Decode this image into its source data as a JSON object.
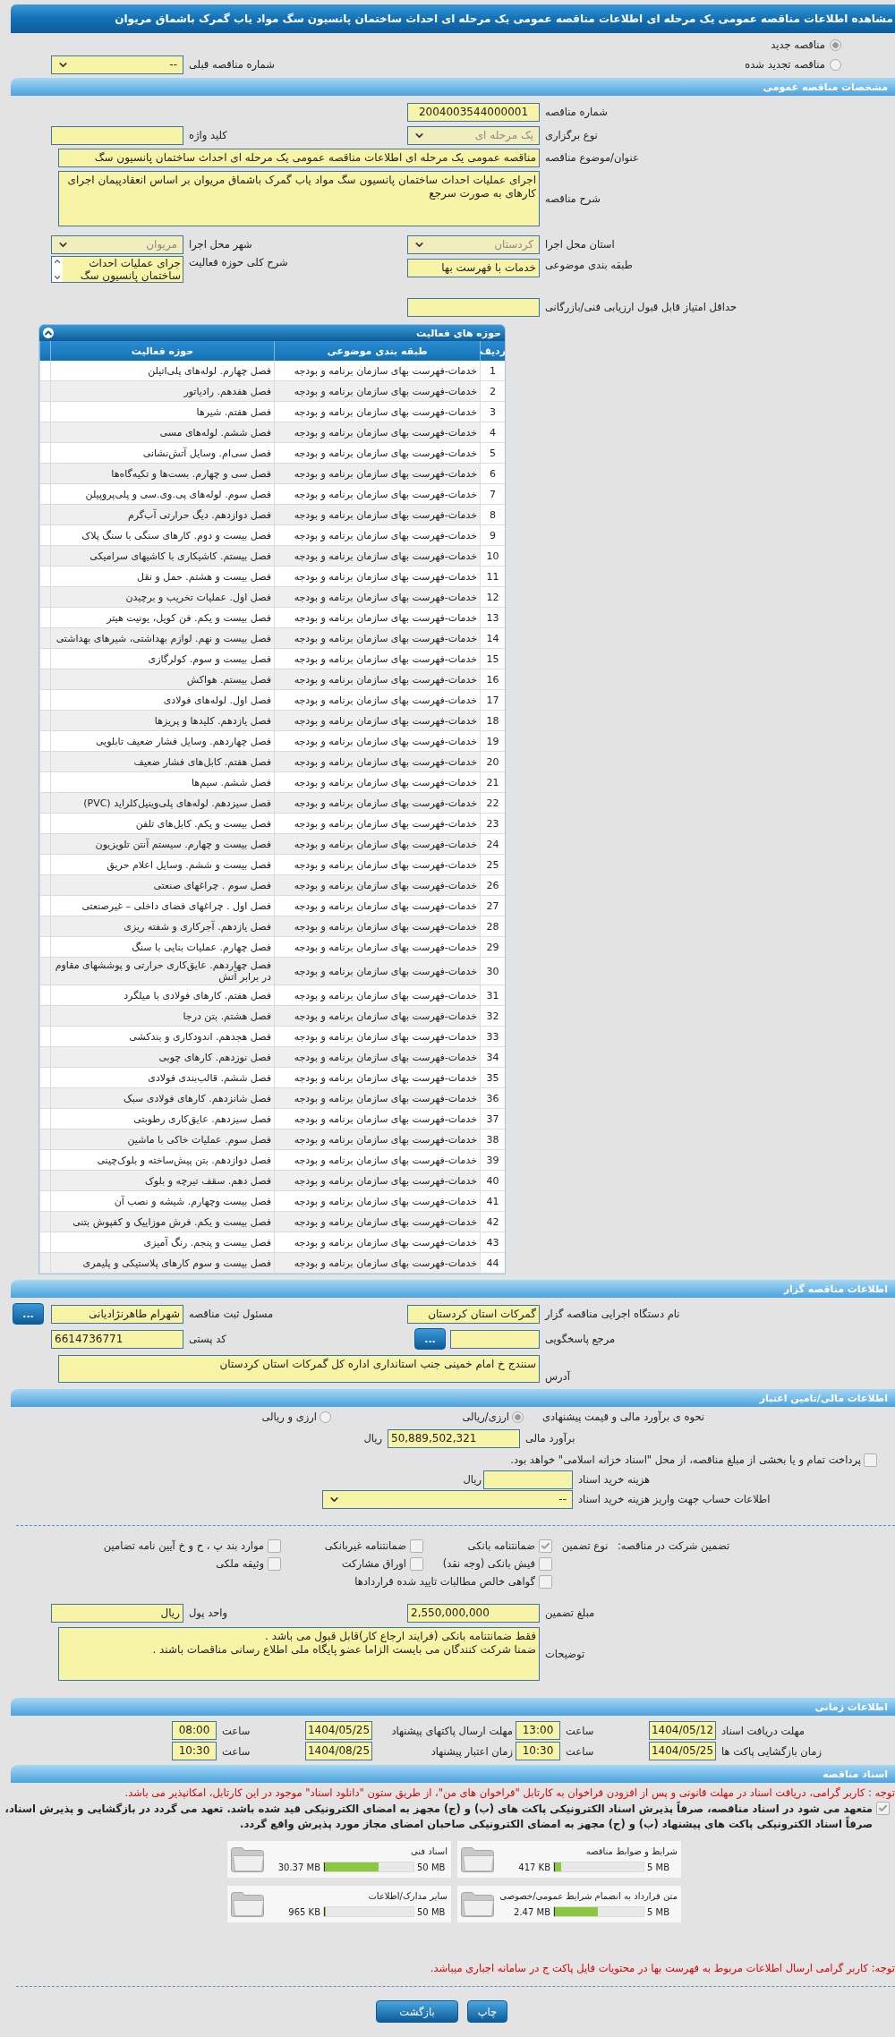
{
  "title": "مشاهده اطلاعات مناقصه عمومی یک مرحله ای اطلاعات مناقصه عمومی یک مرحله ای احداث ساختمان پانسیون سگ مواد یاب گمرک باشماق مریوان",
  "tender_status": [
    {
      "label": "مناقصه جدید",
      "selected": true
    },
    {
      "label": "مناقصه تجدید شده",
      "selected": false
    }
  ],
  "previous_tender": {
    "label": "شماره مناقصه قبلی",
    "value": "--",
    "disabled": false
  },
  "general": {
    "title": "مشخصات مناقصه عمومی",
    "tender_number": {
      "label": "شماره مناقصه",
      "value": "2004003544000001"
    },
    "holding_type": {
      "label": "نوع برگزاری",
      "value": "یک مرحله ای",
      "disabled": true
    },
    "keyword": {
      "label": "کلید واژه"
    },
    "subject": {
      "label": "عنوان/موضوع مناقصه",
      "value": "مناقصه عمومی یک مرحله ای اطلاعات مناقصه عمومی یک مرحله ای احداث ساختمان پانسیون سگ"
    },
    "description": {
      "label": "شرح مناقصه",
      "value": "اجرای عملیات احداث ساختمان پانسیون سگ مواد یاب گمرک باشماق مریوان بر اساس انعقادپیمان اجرای کارهای به صورت سرجع"
    },
    "province": {
      "label": "استان محل اجرا",
      "value": "کردستان",
      "disabled": true
    },
    "city": {
      "label": "شهر محل اجرا",
      "value": "مریوان",
      "disabled": true
    },
    "category": {
      "label": "طبقه بندی موضوعی",
      "value": "خدمات با فهرست بها"
    },
    "activity_scope": {
      "label": "شرح کلی حوزه فعالیت",
      "value": "جرای عملیات احداث ساختمان پانسیون سگ"
    },
    "min_score": {
      "label": "حداقل امتیاز قابل قبول ارزیابی فنی/بازرگانی"
    }
  },
  "activities": {
    "title": "حوزه های فعالیت",
    "columns": [
      "ردیف",
      "طبقه بندی موضوعی",
      "حوزه فعالیت"
    ],
    "rows": [
      {
        "n": "1",
        "category": "خدمات-فهرست بهای سازمان برنامه و بودجه",
        "activity": "فصل چهارم. لوله‌های پلی‌اتیلن"
      },
      {
        "n": "2",
        "category": "خدمات-فهرست بهای سازمان برنامه و بودجه",
        "activity": "فصل هفدهم. رادیاتور"
      },
      {
        "n": "3",
        "category": "خدمات-فهرست بهای سازمان برنامه و بودجه",
        "activity": "فصل هفتم. شیرها"
      },
      {
        "n": "4",
        "category": "خدمات-فهرست بهای سازمان برنامه و بودجه",
        "activity": "فصل ششم. لوله‌های مسی"
      },
      {
        "n": "5",
        "category": "خدمات-فهرست بهای سازمان برنامه و بودجه",
        "activity": "فصل سی‌ام. وسایل آتش‌نشانی"
      },
      {
        "n": "6",
        "category": "خدمات-فهرست بهای سازمان برنامه و بودجه",
        "activity": "فصل سی و چهارم. بست‌ها و تکیه‌گاه‌ها"
      },
      {
        "n": "7",
        "category": "خدمات-فهرست بهای سازمان برنامه و بودجه",
        "activity": "فصل سوم. لوله‌های پی.وی.سی و پلی‌پروپیلن"
      },
      {
        "n": "8",
        "category": "خدمات-فهرست بهای سازمان برنامه و بودجه",
        "activity": "فصل دوازدهم. دیگ حرارتی آب‌گرم"
      },
      {
        "n": "9",
        "category": "خدمات-فهرست بهای سازمان برنامه و بودجه",
        "activity": "فصل بیست و دوم. کارهای سنگی با سنگ پلاک"
      },
      {
        "n": "10",
        "category": "خدمات-فهرست بهای سازمان برنامه و بودجه",
        "activity": "فصل بیستم. کاشیکاری با کاشیهای سرامیکی"
      },
      {
        "n": "11",
        "category": "خدمات-فهرست بهای سازمان برنامه و بودجه",
        "activity": "فصل بیست و هشتم. حمل و نقل"
      },
      {
        "n": "12",
        "category": "خدمات-فهرست بهای سازمان برنامه و بودجه",
        "activity": "فصل اول. عملیات تخریب و برچیدن"
      },
      {
        "n": "13",
        "category": "خدمات-فهرست بهای سازمان برنامه و بودجه",
        "activity": "فصل بیست و یکم. فن کویل، یونیت هیتر"
      },
      {
        "n": "14",
        "category": "خدمات-فهرست بهای سازمان برنامه و بودجه",
        "activity": "فصل بیست و نهم. لوازم بهداشتی، شیرهای بهداشتی"
      },
      {
        "n": "15",
        "category": "خدمات-فهرست بهای سازمان برنامه و بودجه",
        "activity": "فصل بیست و سوم. کولرگازی"
      },
      {
        "n": "16",
        "category": "خدمات-فهرست بهای سازمان برنامه و بودجه",
        "activity": "فصل بیستم. هواکش"
      },
      {
        "n": "17",
        "category": "خدمات-فهرست بهای سازمان برنامه و بودجه",
        "activity": "فصل اول. لوله‌های فولادی"
      },
      {
        "n": "18",
        "category": "خدمات-فهرست بهای سازمان برنامه و بودجه",
        "activity": "فصل یازدهم. کلیدها و پریزها"
      },
      {
        "n": "19",
        "category": "خدمات-فهرست بهای سازمان برنامه و بودجه",
        "activity": "فصل چهاردهم. وسایل فشار ضعیف تابلویی"
      },
      {
        "n": "20",
        "category": "خدمات-فهرست بهای سازمان برنامه و بودجه",
        "activity": "فصل هفتم. کابل‌های فشار ضعیف"
      },
      {
        "n": "21",
        "category": "خدمات-فهرست بهای سازمان برنامه و بودجه",
        "activity": "فصل ششم. سیم‌ها"
      },
      {
        "n": "22",
        "category": "خدمات-فهرست بهای سازمان برنامه و بودجه",
        "activity": "فصل سیزدهم. لوله‌های پلی‌وینیل‌کلراید (PVC)"
      },
      {
        "n": "23",
        "category": "خدمات-فهرست بهای سازمان برنامه و بودجه",
        "activity": "فصل بیست و یکم. کابل‌های تلفن"
      },
      {
        "n": "24",
        "category": "خدمات-فهرست بهای سازمان برنامه و بودجه",
        "activity": "فصل بیست و چهارم. سیستم آنتن تلویزیون"
      },
      {
        "n": "25",
        "category": "خدمات-فهرست بهای سازمان برنامه و بودجه",
        "activity": "فصل بیست و ششم. وسایل اعلام حریق"
      },
      {
        "n": "26",
        "category": "خدمات-فهرست بهای سازمان برنامه و بودجه",
        "activity": "فصل سوم . چراغهای صنعتی"
      },
      {
        "n": "27",
        "category": "خدمات-فهرست بهای سازمان برنامه و بودجه",
        "activity": "فصل اول . چراغهای فضای داخلی – غیرصنعتی"
      },
      {
        "n": "28",
        "category": "خدمات-فهرست بهای سازمان برنامه و بودجه",
        "activity": "فصل یازدهم. آجرکاری و شفته ریزی"
      },
      {
        "n": "29",
        "category": "خدمات-فهرست بهای سازمان برنامه و بودجه",
        "activity": "فصل چهارم. عملیات بنایی با سنگ"
      },
      {
        "n": "30",
        "category": "خدمات-فهرست بهای سازمان برنامه و بودجه",
        "activity": "فصل چهاردهم. عایق‌کاری حرارتی و پوششهای مقاوم در برابر آتش"
      },
      {
        "n": "31",
        "category": "خدمات-فهرست بهای سازمان برنامه و بودجه",
        "activity": "فصل هفتم. کارهای فولادی با میلگرد"
      },
      {
        "n": "32",
        "category": "خدمات-فهرست بهای سازمان برنامه و بودجه",
        "activity": "فصل هشتم. بتن درجا"
      },
      {
        "n": "33",
        "category": "خدمات-فهرست بهای سازمان برنامه و بودجه",
        "activity": "فصل هجدهم. اندودکاری و بندکشی"
      },
      {
        "n": "34",
        "category": "خدمات-فهرست بهای سازمان برنامه و بودجه",
        "activity": "فصل نوزدهم. کارهای چوبی"
      },
      {
        "n": "35",
        "category": "خدمات-فهرست بهای سازمان برنامه و بودجه",
        "activity": "فصل ششم. قالب‌بندی فولادی"
      },
      {
        "n": "36",
        "category": "خدمات-فهرست بهای سازمان برنامه و بودجه",
        "activity": "فصل شانزدهم. کارهای فولادی سبک"
      },
      {
        "n": "37",
        "category": "خدمات-فهرست بهای سازمان برنامه و بودجه",
        "activity": "فصل سیزدهم. عایق‌کاری رطوبتی"
      },
      {
        "n": "38",
        "category": "خدمات-فهرست بهای سازمان برنامه و بودجه",
        "activity": "فصل سوم. عملیات خاکی با ماشین"
      },
      {
        "n": "39",
        "category": "خدمات-فهرست بهای سازمان برنامه و بودجه",
        "activity": "فصل دوازدهم. بتن پیش‌ساخته و بلوک‌چینی"
      },
      {
        "n": "40",
        "category": "خدمات-فهرست بهای سازمان برنامه و بودجه",
        "activity": "فصل دهم. سقف تیرچه و بلوک"
      },
      {
        "n": "41",
        "category": "خدمات-فهرست بهای سازمان برنامه و بودجه",
        "activity": "فصل بیست وچهارم. شیشه و نصب آن"
      },
      {
        "n": "42",
        "category": "خدمات-فهرست بهای سازمان برنامه و بودجه",
        "activity": "فصل بیست و یکم. فرش موزاییک و کفپوش بتنی"
      },
      {
        "n": "43",
        "category": "خدمات-فهرست بهای سازمان برنامه و بودجه",
        "activity": "فصل بیست و پنجم. رنگ آمیزی"
      },
      {
        "n": "44",
        "category": "خدمات-فهرست بهای سازمان برنامه و بودجه",
        "activity": "فصل بیست و سوم کارهای پلاستیکی و پلیمری"
      }
    ]
  },
  "organizer": {
    "title": "اطلاعات مناقصه گزار",
    "more_button": "...",
    "agency": {
      "label": "نام دستگاه اجرایی مناقصه گزار",
      "value": "گمرکات استان کردستان"
    },
    "registrar": {
      "label": "مسئول ثبت مناقصه",
      "value": "شهرام طاهرنژادیانی"
    },
    "response_ref": {
      "label": "مرجع پاسخگویی"
    },
    "postal_code": {
      "label": "کد پستی",
      "value": "6614736771"
    },
    "address": {
      "label": "آدرس",
      "value": "سنندج خ امام خمینی جنب استانداری اداره کل گمرکات استان کردستان"
    }
  },
  "finance": {
    "title": "اطلاعات مالی/تامین اعتبار",
    "method": {
      "label": "نحوه ی برآورد مالی و قیمت پیشنهادی",
      "options": [
        {
          "label": "ارزی/ریالی",
          "selected": true
        },
        {
          "label": "ارزی و ریالی",
          "selected": false
        }
      ]
    },
    "estimate": {
      "label": "برآورد مالی",
      "value": "50,889,502,321",
      "unit": "ریال"
    },
    "treasury": {
      "label": "پرداخت تمام و یا بخشی از مبلغ مناقصه، از محل \"اسناد خزانه اسلامی\" خواهد بود.",
      "checked": false
    },
    "doc_fee": {
      "label": "هزینه خرید اسناد",
      "unit": "ریال"
    },
    "account": {
      "label": "اطلاعات حساب جهت واریز هزینه خرید اسناد",
      "value": "--",
      "disabled": false
    },
    "guarantee_label": "تضمین شرکت در مناقصه:",
    "guarantee_type_label": "نوع تضمین",
    "guarantees": [
      {
        "label": "ضمانتنامه بانکی",
        "checked": true
      },
      {
        "label": "ضمانتنامه غیربانکی",
        "checked": false
      },
      {
        "label": "موارد بند پ ، ح و خ آیین نامه تضامین",
        "checked": false
      },
      {
        "label": "فیش بانکی (وجه نقد)",
        "checked": false
      },
      {
        "label": "اوراق مشارکت",
        "checked": false
      },
      {
        "label": "وثیقه ملکی",
        "checked": false
      },
      {
        "label": "گواهی خالص مطالبات تایید شده قراردادها",
        "checked": false
      }
    ],
    "amount": {
      "label": "مبلغ تضمین",
      "value": "2,550,000,000"
    },
    "currency": {
      "label": "واحد پول",
      "value": "ریال"
    },
    "notes": {
      "label": "توضیحات",
      "value": "فقط ضمانتنامه بانکی (فرایند ارجاع کار)قابل قبول می باشد .\nضمنا شرکت کنندگان می بایست الزاما عضو پایگاه ملی اطلاع رسانی مناقصات باشند ."
    }
  },
  "timing": {
    "title": "اطلاعات زمانی",
    "items": [
      {
        "label": "مهلت دریافت اسناد",
        "date": "1404/05/12",
        "time_label": "ساعت",
        "time": "13:00"
      },
      {
        "label": "مهلت ارسال پاکتهای پیشنهاد",
        "date": "1404/05/25",
        "time_label": "ساعت",
        "time": "08:00"
      },
      {
        "label": "زمان بازگشایی پاکت ها",
        "date": "1404/05/25",
        "time_label": "ساعت",
        "time": "10:30"
      },
      {
        "label": "زمان اعتبار پیشنهاد",
        "date": "1404/08/25",
        "time_label": "ساعت",
        "time": "10:30"
      }
    ]
  },
  "documents": {
    "title": "اسناد مناقصه",
    "notice": "توجه : کاربر گرامی، دریافت اسناد در مهلت قانونی و پس از افزودن فراخوان به کارتابل \"فراخوان های من\"، از طریق ستون \"دانلود اسناد\" موجود در این کارتابل، امکانپذیر می باشد.",
    "commitment": {
      "checked": true,
      "text": "متعهد می شود در اسناد مناقصه، صرفاً پذیرش اسناد الکترونیکی پاکت های (ب) و (ج) مجهز به امضای الکترونیکی قید شده باشد. تعهد می گردد در بازگشایی و پذیرش اسناد، صرفاً اسناد الکترونیکی پاکت های پیشنهاد (ب) و (ج) مجهز به امضای الکترونیکی صاحبان امضای مجاز مورد پذیرش واقع گردد."
    },
    "files": [
      {
        "name": "شرایط و ضوابط مناقصه",
        "size": "417 KB",
        "max": "5 MB",
        "level": 0.08
      },
      {
        "name": "اسناد فنی",
        "size": "30.37 MB",
        "max": "50 MB",
        "level": 0.61
      },
      {
        "name": "متن قرارداد به انضمام شرایط عمومی/خصوصی",
        "size": "2.47 MB",
        "max": "5 MB",
        "level": 0.49
      },
      {
        "name": "سایر مدارک/اطلاعات",
        "size": "965 KB",
        "max": "50 MB",
        "level": 0.02
      }
    ],
    "footer_note": "توجه: کاربر گرامی ارسال اطلاعات مربوط به فهرست بها در محتویات فایل پاکت ج در سامانه اجباری میباشد."
  },
  "buttons": [
    "چاپ",
    "بازگشت"
  ]
}
